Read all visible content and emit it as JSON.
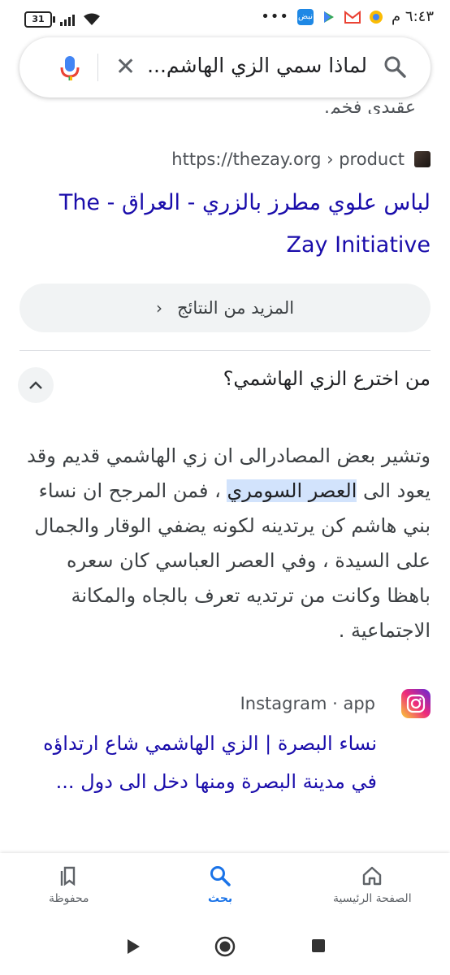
{
  "status_bar": {
    "time": "٦:٤٣ م",
    "battery": "31",
    "notif_app_label": "نبض",
    "overflow_dots": "•••"
  },
  "search": {
    "query": "لماذا سمي الزي الهاشم...",
    "clear_glyph": "✕"
  },
  "top_snippet_fragment": "عقيدي فخم.",
  "result1": {
    "url": "https://thezay.org › product",
    "title": "لباس علوي مطرز بالزري - العراق - The Zay Initiative"
  },
  "more_results_label": "المزيد من النتائج",
  "people_also_ask": {
    "question": "من اخترع الزي الهاشمي؟",
    "answer_before": "وتشير بعض المصادرالى ان زي الهاشمي قديم وقد يعود الى ",
    "answer_highlight": "العصر السومري",
    "answer_after": " ، فمن المرجح ان نساء بني هاشم كن يرتدينه لكونه يضفي الوقار والجمال على السيدة ، وفي العصر العباسي كان سعره باهظا وكانت من ترتديه تعرف بالجاه والمكانة الاجتماعية ."
  },
  "result2": {
    "source": "Instagram · app",
    "title": "نساء البصرة | الزي الهاشمي شاع ارتداؤه في مدينة البصرة ومنها دخل الى دول ..."
  },
  "bottom_nav": {
    "home": "الصفحة الرئيسية",
    "search": "بحث",
    "saved": "محفوظة"
  },
  "colors": {
    "link": "#1a0dab",
    "accent": "#1a73e8",
    "highlight": "#d2e3fc"
  }
}
